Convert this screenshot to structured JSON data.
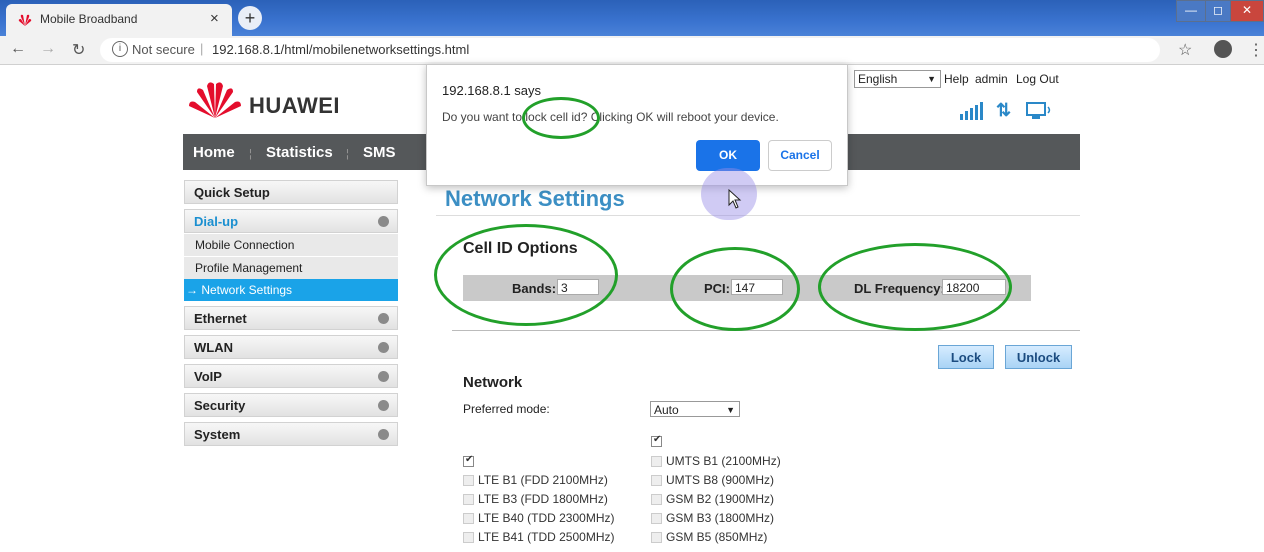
{
  "browser": {
    "tab_title": "Mobile Broadband",
    "tab_close": "×",
    "new_tab": "+",
    "security_label": "Not secure",
    "url": "192.168.8.1/html/mobilenetworksettings.html",
    "window_buttons": [
      "—",
      "◻",
      "✕"
    ]
  },
  "header": {
    "logo_text": "HUAWEI",
    "language": "English",
    "links": [
      "Help",
      "admin",
      "Log Out"
    ],
    "brand_red": "#e40d2c"
  },
  "topnav": {
    "items": [
      "Home",
      "Statistics",
      "SMS"
    ]
  },
  "sidebar": {
    "sections": [
      {
        "label": "Quick Setup"
      },
      {
        "label": "Dial-up",
        "expanded": true,
        "children": [
          "Mobile Connection",
          "Profile Management",
          "→ Network Settings"
        ]
      },
      {
        "label": "Ethernet"
      },
      {
        "label": "WLAN"
      },
      {
        "label": "VoIP"
      },
      {
        "label": "Security"
      },
      {
        "label": "System"
      }
    ],
    "active_color": "#1aa3e8"
  },
  "main": {
    "title": "Network Settings",
    "cell_id": {
      "heading": "Cell ID Options",
      "bands_label": "Bands:",
      "bands_value": "3",
      "pci_label": "PCI:",
      "pci_value": "147",
      "dlfreq_label": "DL Frequency:",
      "dlfreq_value": "18200"
    },
    "lock_button": "Lock",
    "unlock_button": "Unlock",
    "network_heading": "Network",
    "preferred_mode_label": "Preferred mode:",
    "preferred_mode_value": "Auto",
    "lte_bands": [
      "LTE B1 (FDD 2100MHz)",
      "LTE B3 (FDD 1800MHz)",
      "LTE B40 (TDD 2300MHz)",
      "LTE B41 (TDD 2500MHz)"
    ],
    "umts_gsm_bands": [
      "UMTS B1 (2100MHz)",
      "UMTS B8 (900MHz)",
      "GSM B2 (1900MHz)",
      "GSM B3 (1800MHz)",
      "GSM B5 (850MHz)"
    ]
  },
  "dialog": {
    "title": "192.168.8.1 says",
    "message": "Do you want to lock cell id? Clicking OK will reboot your device.",
    "ok": "OK",
    "cancel": "Cancel"
  }
}
